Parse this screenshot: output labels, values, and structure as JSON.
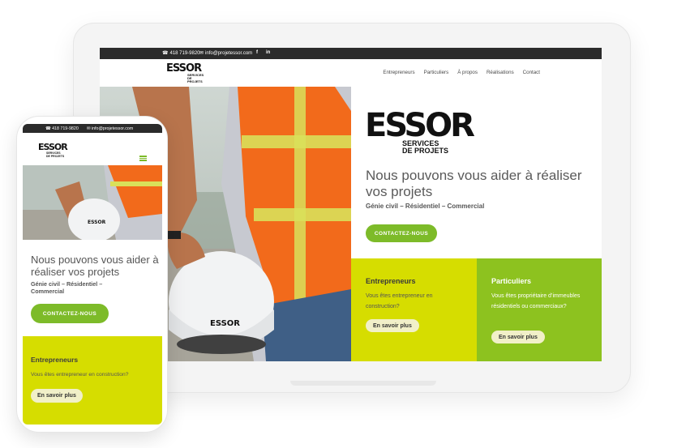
{
  "contact": {
    "phone": "418 719-9820",
    "email": "info@projetessor.com"
  },
  "social": {
    "facebook": "f",
    "linkedin": "in"
  },
  "brand": {
    "name": "ESSOR",
    "tagline_line1": "SERVICES",
    "tagline_line2": "DE PROJETS"
  },
  "nav": {
    "items": [
      "Entrepreneurs",
      "Particuliers",
      "À propos",
      "Réalisations",
      "Contact"
    ]
  },
  "hero": {
    "title": "Nous pouvons vous aider à réaliser vos projets",
    "subtitle": "Génie civil – Résidentiel – Commercial",
    "cta": "CONTACTEZ-NOUS"
  },
  "cards": [
    {
      "title": "Entrepreneurs",
      "text": "Vous êtes entrepreneur en construction?",
      "button": "En savoir plus"
    },
    {
      "title": "Particuliers",
      "text": "Vous êtes propriétaire d’immeubles résidentiels ou commerciaux?",
      "button": "En savoir plus"
    }
  ],
  "mobile": {
    "hero_title": "Nous pouvons vous aider à réaliser vos projets",
    "hero_subtitle": "Génie civil – Résidentiel – Commercial",
    "cta": "CONTACTEZ-NOUS",
    "card": {
      "title": "Entrepreneurs",
      "text": "Vous êtes entrepreneur en construction?",
      "button": "En savoir plus"
    }
  },
  "colors": {
    "lime": "#d6dd00",
    "green": "#8dc21f",
    "cta": "#7dbb29",
    "dark": "#2b2b2b"
  }
}
